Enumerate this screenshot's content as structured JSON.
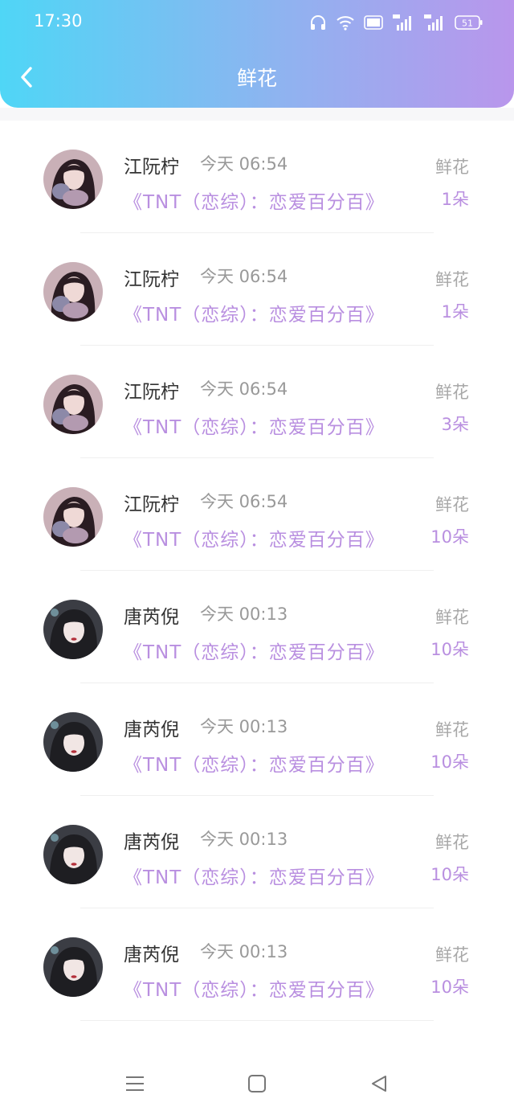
{
  "status_bar": {
    "time": "17:30",
    "battery": "51"
  },
  "header": {
    "title": "鲜花"
  },
  "colors": {
    "accent": "#b98fe0",
    "gradient_start": "#4fd6f6",
    "gradient_end": "#b996ec"
  },
  "items": [
    {
      "name": "江阮柠",
      "time": "今天 06:54",
      "subtitle": "《TNT（恋综）：恋爱百分百》",
      "type": "鲜花",
      "count": "1朵",
      "avatar": "avatar-a"
    },
    {
      "name": "江阮柠",
      "time": "今天 06:54",
      "subtitle": "《TNT（恋综）：恋爱百分百》",
      "type": "鲜花",
      "count": "1朵",
      "avatar": "avatar-a"
    },
    {
      "name": "江阮柠",
      "time": "今天 06:54",
      "subtitle": "《TNT（恋综）：恋爱百分百》",
      "type": "鲜花",
      "count": "3朵",
      "avatar": "avatar-a"
    },
    {
      "name": "江阮柠",
      "time": "今天 06:54",
      "subtitle": "《TNT（恋综）：恋爱百分百》",
      "type": "鲜花",
      "count": "10朵",
      "avatar": "avatar-a"
    },
    {
      "name": "唐芮倪",
      "time": "今天 00:13",
      "subtitle": "《TNT（恋综）：恋爱百分百》",
      "type": "鲜花",
      "count": "10朵",
      "avatar": "avatar-b"
    },
    {
      "name": "唐芮倪",
      "time": "今天 00:13",
      "subtitle": "《TNT（恋综）：恋爱百分百》",
      "type": "鲜花",
      "count": "10朵",
      "avatar": "avatar-b"
    },
    {
      "name": "唐芮倪",
      "time": "今天 00:13",
      "subtitle": "《TNT（恋综）：恋爱百分百》",
      "type": "鲜花",
      "count": "10朵",
      "avatar": "avatar-b"
    },
    {
      "name": "唐芮倪",
      "time": "今天 00:13",
      "subtitle": "《TNT（恋综）：恋爱百分百》",
      "type": "鲜花",
      "count": "10朵",
      "avatar": "avatar-b"
    }
  ],
  "nav": {
    "icons": [
      "menu-icon",
      "home-icon",
      "back-triangle-icon"
    ]
  }
}
